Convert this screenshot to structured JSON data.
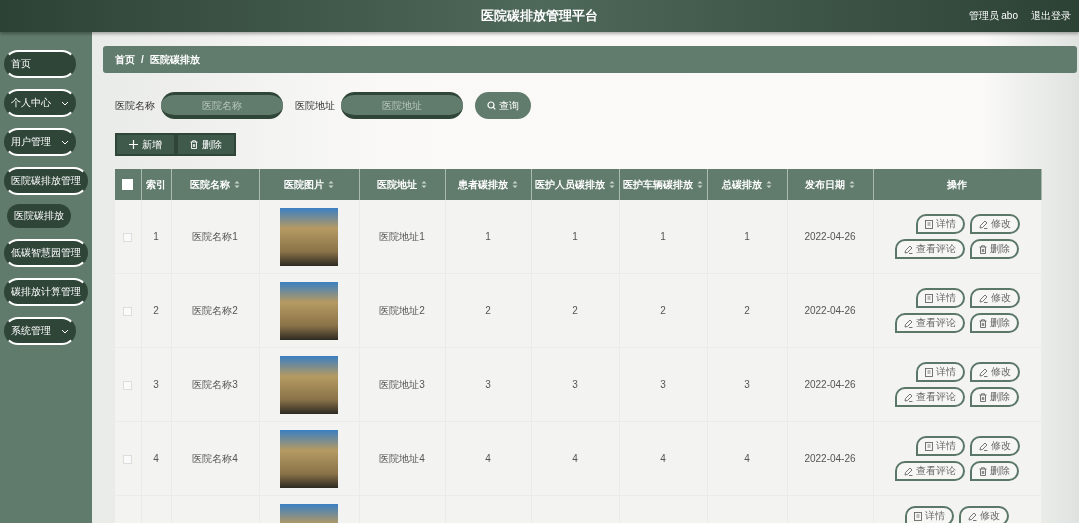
{
  "header": {
    "title": "医院碳排放管理平台",
    "user": "管理员 abo",
    "logout": "退出登录"
  },
  "sidebar": {
    "items": [
      {
        "label": "首页",
        "kind": "link",
        "selected": false
      },
      {
        "label": "个人中心",
        "kind": "menu",
        "expanded": false,
        "selected": false
      },
      {
        "label": "用户管理",
        "kind": "menu",
        "expanded": false,
        "selected": false
      },
      {
        "label": "医院碳排放管理",
        "kind": "menu",
        "expanded": true,
        "selected": false,
        "children": [
          {
            "label": "医院碳排放",
            "selected": true
          }
        ]
      },
      {
        "label": "低碳智慧园管理",
        "kind": "link",
        "selected": false
      },
      {
        "label": "碳排放计算管理",
        "kind": "link",
        "selected": false
      },
      {
        "label": "系统管理",
        "kind": "menu",
        "expanded": false,
        "selected": false
      }
    ]
  },
  "breadcrumb": {
    "items": [
      "首页",
      "医院碳排放"
    ],
    "separator": "/"
  },
  "search": {
    "fields": [
      {
        "label": "医院名称",
        "placeholder": "医院名称"
      },
      {
        "label": "医院地址",
        "placeholder": "医院地址"
      }
    ],
    "button": "查询"
  },
  "toolbar": [
    {
      "label": "新增",
      "kind": "add"
    },
    {
      "label": "删除",
      "kind": "delete"
    }
  ],
  "table": {
    "columns": [
      {
        "kind": "checkbox",
        "checked": false
      },
      {
        "kind": "text",
        "label": "索引",
        "sortable": false
      },
      {
        "kind": "text",
        "label": "医院名称",
        "sortable": true
      },
      {
        "kind": "image",
        "label": "医院图片",
        "sortable": true
      },
      {
        "kind": "text",
        "label": "医院地址",
        "sortable": true
      },
      {
        "kind": "text",
        "label": "患者碳排放",
        "sortable": true
      },
      {
        "kind": "text",
        "label": "医护人员碳排放",
        "sortable": true
      },
      {
        "kind": "text",
        "label": "医护车辆碳排放",
        "sortable": true
      },
      {
        "kind": "text",
        "label": "总碳排放",
        "sortable": true
      },
      {
        "kind": "text",
        "label": "发布日期",
        "sortable": true
      },
      {
        "kind": "actions",
        "label": "操作",
        "sortable": false
      }
    ],
    "rows": [
      {
        "kind": "full",
        "checked": false,
        "cells": [
          "1",
          "医院名称1",
          "医院地址1",
          "1",
          "1",
          "1",
          "1",
          "2022-04-26"
        ],
        "actions": [
          {
            "label": "详情",
            "kind": "detail"
          },
          {
            "label": "修改",
            "kind": "edit"
          },
          {
            "label": "查看评论",
            "kind": "comments"
          },
          {
            "label": "删除",
            "kind": "delete"
          }
        ]
      },
      {
        "kind": "full",
        "checked": false,
        "cells": [
          "2",
          "医院名称2",
          "医院地址2",
          "2",
          "2",
          "2",
          "2",
          "2022-04-26"
        ],
        "actions": [
          {
            "label": "详情",
            "kind": "detail"
          },
          {
            "label": "修改",
            "kind": "edit"
          },
          {
            "label": "查看评论",
            "kind": "comments"
          },
          {
            "label": "删除",
            "kind": "delete"
          }
        ]
      },
      {
        "kind": "full",
        "checked": false,
        "cells": [
          "3",
          "医院名称3",
          "医院地址3",
          "3",
          "3",
          "3",
          "3",
          "2022-04-26"
        ],
        "actions": [
          {
            "label": "详情",
            "kind": "detail"
          },
          {
            "label": "修改",
            "kind": "edit"
          },
          {
            "label": "查看评论",
            "kind": "comments"
          },
          {
            "label": "删除",
            "kind": "delete"
          }
        ]
      },
      {
        "kind": "full",
        "checked": false,
        "cells": [
          "4",
          "医院名称4",
          "医院地址4",
          "4",
          "4",
          "4",
          "4",
          "2022-04-26"
        ],
        "actions": [
          {
            "label": "详情",
            "kind": "detail"
          },
          {
            "label": "修改",
            "kind": "edit"
          },
          {
            "label": "查看评论",
            "kind": "comments"
          },
          {
            "label": "删除",
            "kind": "delete"
          }
        ]
      },
      {
        "kind": "partial",
        "actions": [
          {
            "label": "详情",
            "kind": "detail"
          },
          {
            "label": "修改",
            "kind": "edit"
          }
        ]
      }
    ]
  }
}
